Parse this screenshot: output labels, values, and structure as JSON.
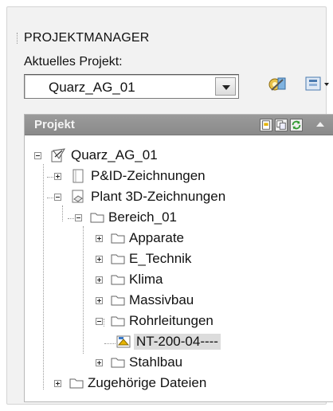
{
  "header": {
    "title": "PROJEKTMANAGER"
  },
  "current_project": {
    "label": "Aktuelles Projekt:",
    "selected": "Quarz_AG_01"
  },
  "toolbar": {
    "icons": [
      "project-settings-icon",
      "project-views-dropdown-icon"
    ]
  },
  "project_panel": {
    "title": "Projekt",
    "bar_icons": [
      "new-drawing-icon",
      "copy-drawing-icon",
      "refresh-icon",
      "collapse-up-icon"
    ]
  },
  "tree": {
    "root": "Quarz_AG_01",
    "pid": "P&ID-Zeichnungen",
    "plant3d": "Plant 3D-Zeichnungen",
    "bereich": "Bereich_01",
    "folders": [
      "Apparate",
      "E_Technik",
      "Klima",
      "Massivbau",
      "Rohrleitungen"
    ],
    "drawing": "NT-200-04----",
    "stahlbau": "Stahlbau",
    "related": "Zugehörige Dateien"
  }
}
